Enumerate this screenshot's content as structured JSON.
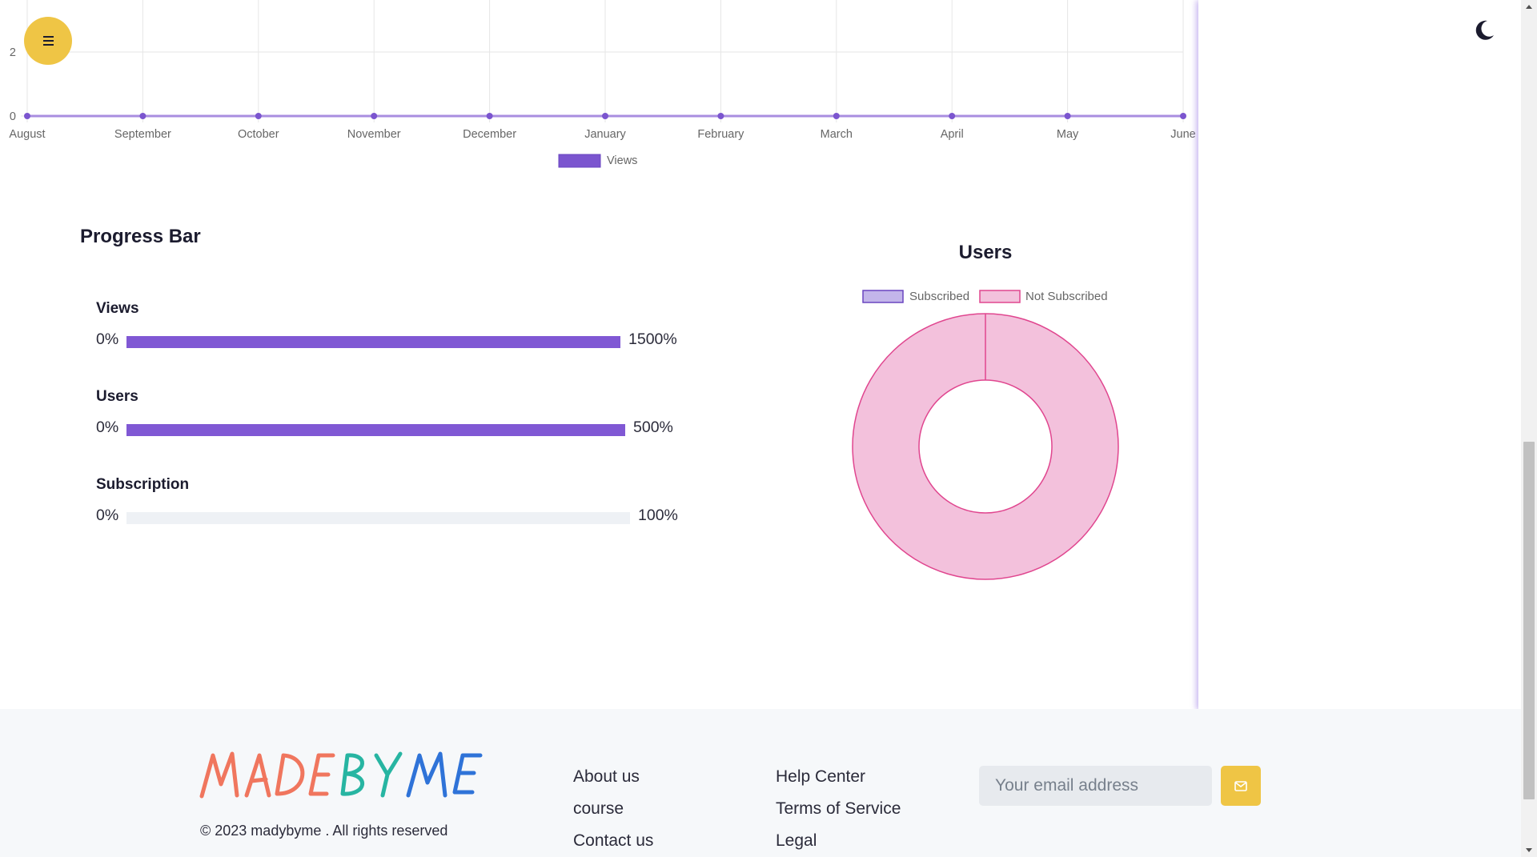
{
  "header": {
    "menu_icon": "menu-icon",
    "theme_icon": "moon-icon"
  },
  "line_chart": {
    "y_ticks": [
      "0",
      "2"
    ],
    "x_ticks": [
      "August",
      "September",
      "October",
      "November",
      "December",
      "January",
      "February",
      "March",
      "April",
      "May",
      "June"
    ],
    "legend_label": "Views",
    "line_color": "#7b55cf"
  },
  "progress": {
    "title": "Progress Bar",
    "items": [
      {
        "label": "Views",
        "min": "0%",
        "max": "1500%",
        "fill": 1.0
      },
      {
        "label": "Users",
        "min": "0%",
        "max": "500%",
        "fill": 1.0
      },
      {
        "label": "Subscription",
        "min": "0%",
        "max": "100%",
        "fill": 0.0
      }
    ],
    "fill_color": "#8058d4"
  },
  "donut": {
    "title": "Users",
    "legend": [
      "Subscribed",
      "Not Subscribed"
    ],
    "colors": {
      "subscribed": "#c3b5ea",
      "not_subscribed": "#f3c1dc"
    }
  },
  "chart_data": [
    {
      "type": "line",
      "title": "",
      "x": [
        "August",
        "September",
        "October",
        "November",
        "December",
        "January",
        "February",
        "March",
        "April",
        "May",
        "June"
      ],
      "series": [
        {
          "name": "Views",
          "values": [
            0,
            0,
            0,
            0,
            0,
            0,
            0,
            0,
            0,
            0,
            0
          ]
        }
      ],
      "grid": true,
      "legend": "bottom"
    },
    {
      "type": "pie",
      "title": "Users",
      "categories": [
        "Subscribed",
        "Not Subscribed"
      ],
      "values": [
        0,
        100
      ],
      "legend": "top"
    }
  ],
  "footer": {
    "logo": "MADEBYME",
    "copyright": "© 2023 madybyme . All rights reserved",
    "links_col1": [
      "About us",
      "course",
      "Contact us"
    ],
    "links_col2": [
      "Help Center",
      "Terms of Service",
      "Legal"
    ],
    "email_placeholder": "Your email address",
    "subscribe_icon": "mail-icon",
    "accent": "#efc545"
  }
}
